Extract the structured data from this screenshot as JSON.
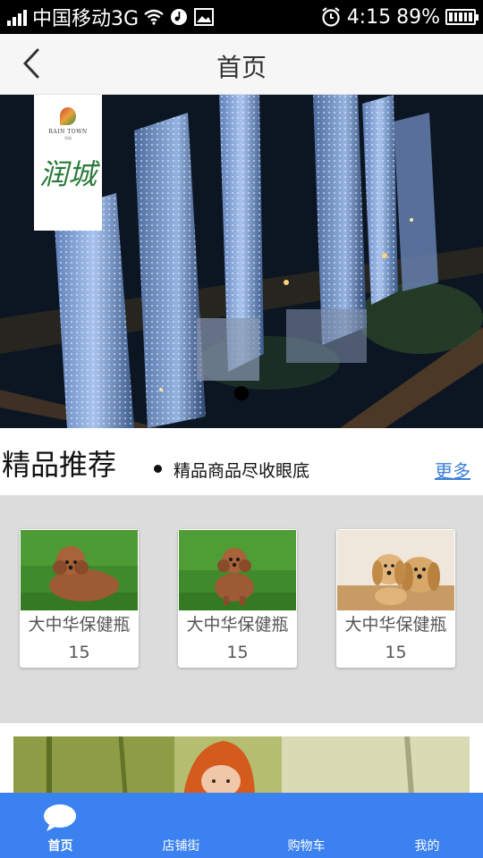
{
  "status_bar": {
    "carrier": "中国移动3G",
    "time": "4:15",
    "battery": "89%"
  },
  "header": {
    "title": "首页",
    "back_icon": "chevron-left-icon"
  },
  "banner": {
    "logo_en": "RAIN TOWN",
    "logo_sub": "润城",
    "logo_cn": "润城",
    "active_slide": 1,
    "slides": 1
  },
  "section": {
    "title": "精品推荐",
    "subtitle": "精品商品尽收眼底",
    "more": "更多"
  },
  "products": [
    {
      "name": "大中华保健瓶",
      "price": "15",
      "image": "poodle-photo"
    },
    {
      "name": "大中华保健瓶",
      "price": "15",
      "image": "poodle-photo"
    },
    {
      "name": "大中华保健瓶",
      "price": "15",
      "image": "dachshund-photo"
    }
  ],
  "tabs": [
    {
      "label": "首页",
      "icon": "chat-bubble-icon",
      "active": true
    },
    {
      "label": "店铺街",
      "active": false
    },
    {
      "label": "购物车",
      "active": false
    },
    {
      "label": "我的",
      "active": false
    }
  ],
  "colors": {
    "accent": "#3b82f0",
    "more_link": "#3b7fd6",
    "grid_bg": "#dcdcdc"
  }
}
